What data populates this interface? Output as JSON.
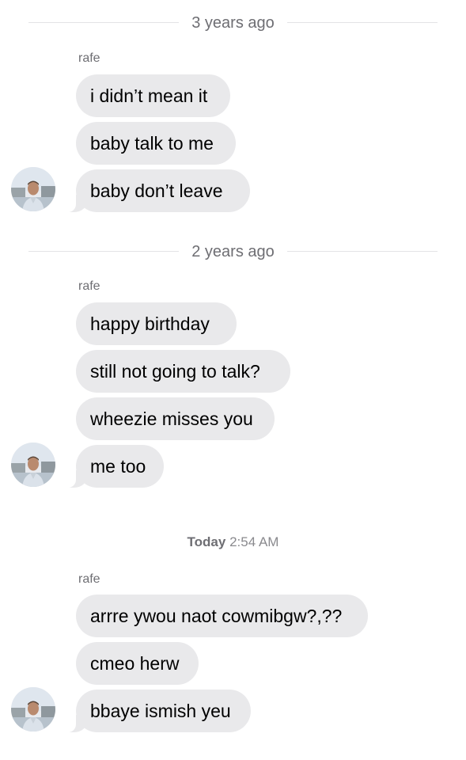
{
  "sections": [
    {
      "divider": "3 years ago",
      "sender": "rafe",
      "messages": [
        "i didn’t mean it",
        "baby talk to me",
        "baby don’t leave"
      ]
    },
    {
      "divider": "2 years ago",
      "sender": "rafe",
      "messages": [
        "happy birthday",
        "still not going to talk?",
        "wheezie misses you",
        "me too"
      ]
    },
    {
      "timestamp_day": "Today",
      "timestamp_time": "2:54 AM",
      "sender": "rafe",
      "messages": [
        "arrre ywou naot cowmibgw?,??",
        "cmeo herw",
        "bbaye ismish yeu"
      ]
    }
  ],
  "avatar_icon": "contact-photo-icon",
  "colors": {
    "bubble": "#e9e9eb",
    "meta_text": "#6e6e73",
    "divider_line": "#e3e3e6"
  }
}
